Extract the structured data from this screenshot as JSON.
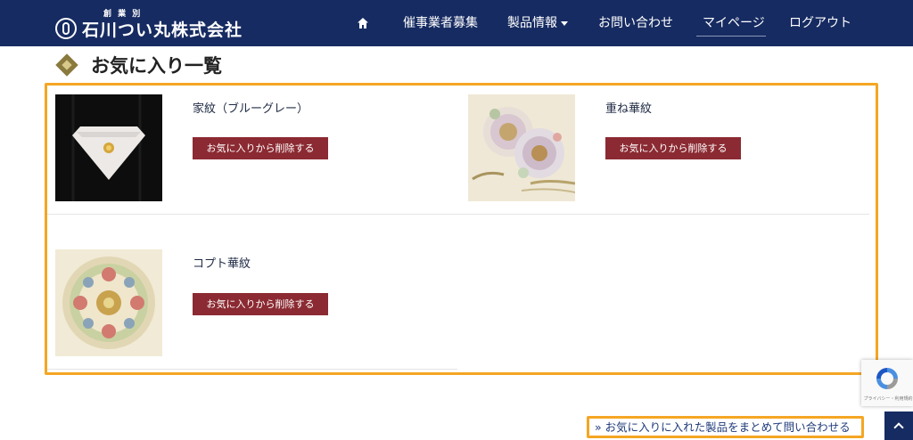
{
  "header": {
    "logo_sub": "創 業 別",
    "logo_name": "石川つい丸株式会社",
    "nav": {
      "home_icon": "home-icon",
      "recruit": "催事業者募集",
      "products": "製品情報",
      "contact": "お問い合わせ",
      "mypage": "マイページ",
      "logout": "ログアウト"
    }
  },
  "page": {
    "title": "お気に入り一覧",
    "title_icon": "diamond-icon"
  },
  "favorites": [
    {
      "name": "家紋（ブルーグレー）",
      "remove_label": "お気に入りから削除する"
    },
    {
      "name": "重ね華紋",
      "remove_label": "お気に入りから削除する"
    },
    {
      "name": "コプト華紋",
      "remove_label": "お気に入りから削除する"
    }
  ],
  "inquiry_link": "» お気に入りに入れた製品をまとめて問い合わせる",
  "recaptcha": {
    "text": "プライバシー・利用規約"
  },
  "colors": {
    "header_bg": "#162b61",
    "button_bg": "#8b2a32",
    "highlight_border": "#f5a623"
  }
}
